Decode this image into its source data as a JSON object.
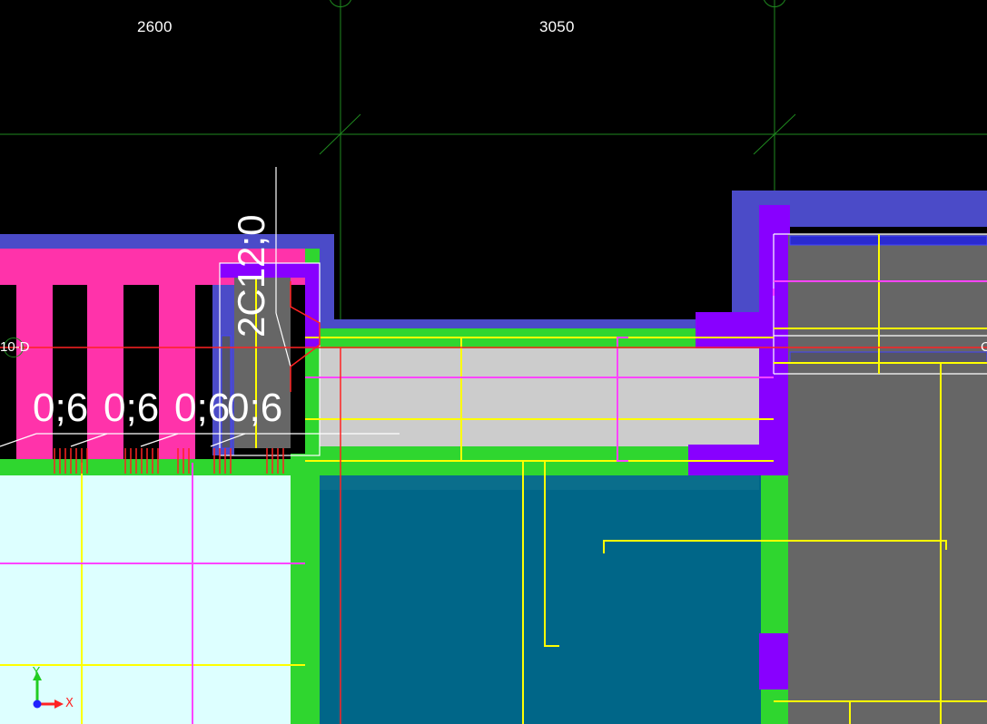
{
  "viewport": {
    "background": "#000000",
    "colors": {
      "grid_line": "#1f8a1f",
      "wall_blue": "#4b4bc8",
      "pink_fill": "#ff33aa",
      "purple_fill": "#8800ff",
      "green_fill": "#2fd62f",
      "slab_teal": "#006688",
      "light_cyan": "#ddffff",
      "grey_fill": "#666666",
      "light_grey": "#cccccc",
      "yellow_line": "#ffff00",
      "magenta_line": "#ff44ff",
      "red_line": "#ff2222",
      "white_line": "#ffffff"
    }
  },
  "dimensions": {
    "left_span": "2600",
    "right_span": "3050"
  },
  "grid_axes": {
    "row_label": "10-D",
    "right_cut_label": "C"
  },
  "annotations": {
    "rebar_labels": [
      "0;6",
      "0;6",
      "0;6",
      "0;6"
    ],
    "cut_label": "2C12;0"
  },
  "ucs": {
    "y_label": "Y",
    "x_label": "X",
    "y_color": "#22cc22",
    "x_color": "#ff2222",
    "origin_color": "#2222ff"
  }
}
